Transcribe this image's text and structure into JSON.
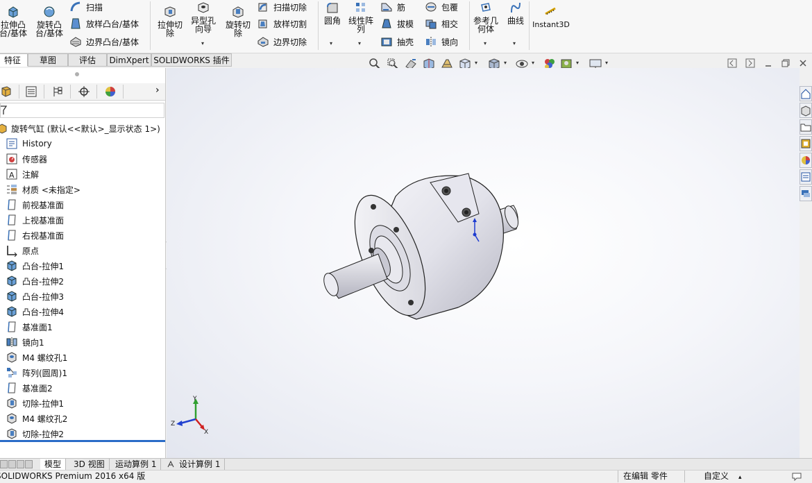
{
  "ribbon": {
    "extrude_boss": "拉伸凸\n台/基体",
    "revolve_boss": "旋转凸\n台/基体",
    "sweep": "扫描",
    "loft_boss": "放样凸台/基体",
    "boundary_boss": "边界凸台/基体",
    "extrude_cut": "拉伸切\n除",
    "hole_wizard": "异型孔\n向导",
    "revolve_cut": "旋转切\n除",
    "swept_cut": "扫描切除",
    "lofted_cut": "放样切割",
    "boundary_cut": "边界切除",
    "fillet": "圆角",
    "linear_pattern": "线性阵\n列",
    "rib": "筋",
    "draft": "拔模",
    "shell": "抽壳",
    "wrap": "包覆",
    "intersect": "相交",
    "mirror": "镜向",
    "ref_geometry": "参考几\n何体",
    "curves": "曲线",
    "instant3d": "Instant3D"
  },
  "tabs": [
    "特征",
    "草图",
    "评估",
    "DimXpert",
    "SOLIDWORKS 插件"
  ],
  "tree": {
    "root": "旋转气缸  (默认<<默认>_显示状态 1>)",
    "items": [
      {
        "label": "History",
        "icon": "history-icon"
      },
      {
        "label": "传感器",
        "icon": "sensor-icon"
      },
      {
        "label": "注解",
        "icon": "annotation-icon"
      },
      {
        "label": "材质 <未指定>",
        "icon": "material-icon"
      },
      {
        "label": "前视基准面",
        "icon": "plane-icon"
      },
      {
        "label": "上视基准面",
        "icon": "plane-icon"
      },
      {
        "label": "右视基准面",
        "icon": "plane-icon"
      },
      {
        "label": "原点",
        "icon": "origin-icon"
      },
      {
        "label": "凸台-拉伸1",
        "icon": "extrude-icon"
      },
      {
        "label": "凸台-拉伸2",
        "icon": "extrude-icon"
      },
      {
        "label": "凸台-拉伸3",
        "icon": "extrude-icon"
      },
      {
        "label": "凸台-拉伸4",
        "icon": "extrude-icon"
      },
      {
        "label": "基准面1",
        "icon": "plane-icon"
      },
      {
        "label": "镜向1",
        "icon": "mirror-icon"
      },
      {
        "label": "M4 螺纹孔1",
        "icon": "hole-icon"
      },
      {
        "label": "阵列(圆周)1",
        "icon": "circular-pattern-icon"
      },
      {
        "label": "基准面2",
        "icon": "plane-icon"
      },
      {
        "label": "切除-拉伸1",
        "icon": "cut-extrude-icon"
      },
      {
        "label": "M4 螺纹孔2",
        "icon": "hole-icon"
      },
      {
        "label": "切除-拉伸2",
        "icon": "cut-extrude-icon"
      }
    ]
  },
  "triad": {
    "x": "X",
    "y": "Y",
    "z": "Z"
  },
  "bottom_tabs": [
    "模型",
    "3D 视图",
    "运动算例 1",
    "设计算例 1"
  ],
  "status": {
    "product": "SOLIDWORKS Premium 2016 x64 版",
    "editing": "在编辑 零件",
    "custom": "自定义"
  },
  "colors": {
    "accent": "#2060c0",
    "part": "#e6e6ec"
  }
}
